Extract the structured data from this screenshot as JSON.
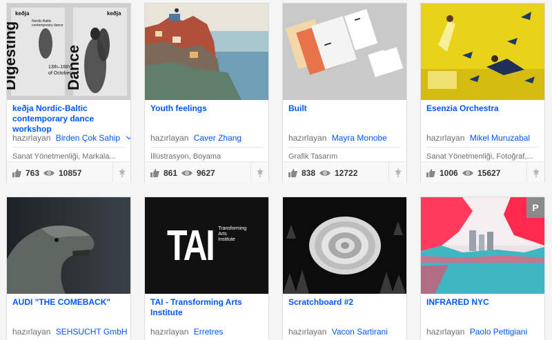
{
  "byline_prefix": "hazırlayan",
  "projects": [
    {
      "title": "keðja Nordic-Baltic contemporary dance workshop",
      "owner": "Birden Çok Sahip",
      "fields": "Sanat Yönetmenliği, Markala...",
      "appreciations": "763",
      "views": "10857",
      "poster": {
        "brand": "keðja",
        "subtitle": "Nordic-Baltic contemporary dance",
        "big1": "Digesting",
        "big2": "Dance",
        "dates": "13th–16th of October"
      }
    },
    {
      "title": "Youth feelings",
      "owner": "Caver Zhang",
      "fields": "İllüstrasyon, Boyama",
      "appreciations": "861",
      "views": "9627"
    },
    {
      "title": "Built",
      "owner": "Mayra Monobe",
      "fields": "Grafik Tasarım",
      "appreciations": "838",
      "views": "12722"
    },
    {
      "title": "Esenzia Orchestra",
      "owner": "Mikel Muruzabal",
      "fields": "Sanat Yönetmenliği, Fotoğraf,...",
      "appreciations": "1006",
      "views": "15627"
    },
    {
      "title": "AUDI \"THE COMEBACK\"",
      "owner": "SEHSUCHT GmbH"
    },
    {
      "title": "TAI - Transforming Arts Institute",
      "owner": "Erretres",
      "logo": {
        "mark": "TAI",
        "line1": "Transforming",
        "line2": "Arts",
        "line3": "Institute"
      }
    },
    {
      "title": "Scratchboard #2",
      "owner": "Vacon Sartirani"
    },
    {
      "title": "INFRARED NYC",
      "owner": "Paolo Pettigiani",
      "badge": "P"
    }
  ],
  "colors": {
    "link": "#0057ff",
    "infrared": "#ff3a5a",
    "yellow": "#e8d21a"
  }
}
